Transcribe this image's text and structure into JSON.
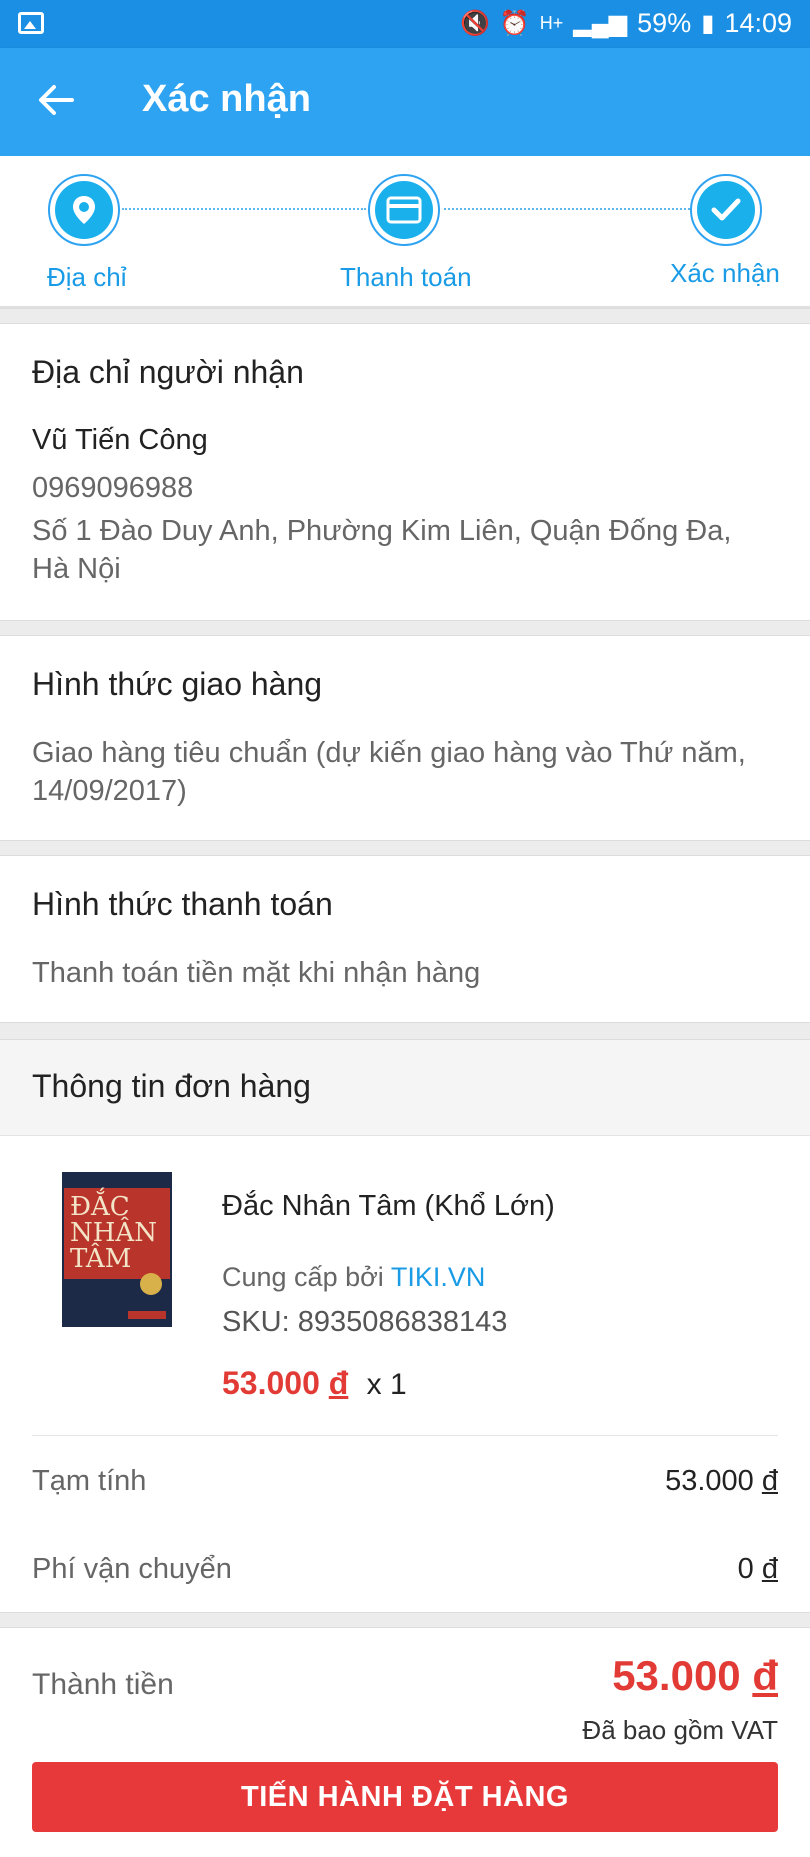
{
  "status_bar": {
    "battery": "59%",
    "time": "14:09",
    "network": "H+"
  },
  "app_bar": {
    "title": "Xác nhận"
  },
  "steps": [
    {
      "label": "Địa chỉ",
      "icon": "location-pin-icon"
    },
    {
      "label": "Thanh toán",
      "icon": "credit-card-icon"
    },
    {
      "label": "Xác nhận",
      "icon": "check-icon"
    }
  ],
  "recipient": {
    "title": "Địa chỉ người nhận",
    "name": "Vũ Tiến Công",
    "phone": "0969096988",
    "address_line1": "Số 1 Đào Duy Anh, Phường Kim Liên, Quận Đống Đa,",
    "address_line2": "Hà Nội"
  },
  "shipping": {
    "title": "Hình thức giao hàng",
    "line1": "Giao hàng tiêu chuẩn (dự kiến giao hàng vào Thứ năm,",
    "line2": "14/09/2017)"
  },
  "payment": {
    "title": "Hình thức thanh toán",
    "method": "Thanh toán tiền mặt khi nhận hàng"
  },
  "order": {
    "title": "Thông tin đơn hàng",
    "item": {
      "name": "Đắc Nhân Tâm (Khổ Lớn)",
      "supplier_prefix": "Cung cấp bởi",
      "supplier": "TIKI.VN",
      "sku": "SKU: 8935086838143",
      "price": "53.000",
      "currency": "đ",
      "quantity": "x 1",
      "cover_text": "ĐẮC NHÂN TÂM"
    },
    "subtotal_label": "Tạm tính",
    "subtotal_value": "53.000",
    "shipping_fee_label": "Phí vận chuyển",
    "shipping_fee_value": "0",
    "currency": "đ"
  },
  "total": {
    "label": "Thành tiền",
    "value": "53.000",
    "currency": "đ",
    "vat_note": "Đã bao gồm VAT"
  },
  "cta": {
    "label": "TIẾN HÀNH ĐẶT HÀNG"
  },
  "colors": {
    "primary": "#2ea3f2",
    "status_bar": "#1a8fe3",
    "price_red": "#e23a35",
    "button_red": "#e8393a",
    "link_blue": "#1a9be6"
  }
}
